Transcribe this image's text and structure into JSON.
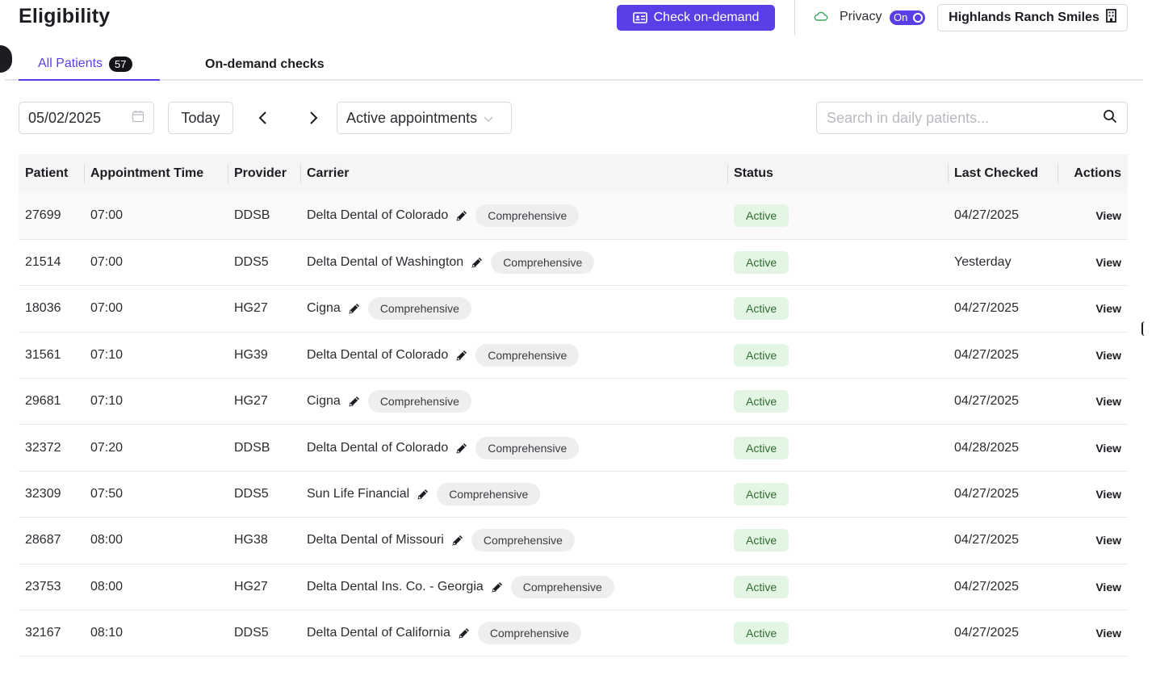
{
  "header": {
    "title": "Eligibility",
    "check_button_label": "Check on-demand",
    "privacy_label": "Privacy",
    "privacy_toggle_label": "On",
    "office_name": "Highlands Ranch Smiles"
  },
  "tabs": [
    {
      "label": "All Patients",
      "count": "57",
      "active": true
    },
    {
      "label": "On-demand checks",
      "active": false
    }
  ],
  "filters": {
    "date": "05/02/2025",
    "today_label": "Today",
    "appointment_filter": "Active appointments",
    "search_placeholder": "Search in daily patients..."
  },
  "table": {
    "columns": [
      "Patient",
      "Appointment Time",
      "Provider",
      "Carrier",
      "Status",
      "Last Checked",
      "Actions"
    ],
    "rows": [
      {
        "patient": "27699",
        "time": "07:00",
        "provider": "DDSB",
        "carrier": "Delta Dental of Colorado",
        "plan": "Comprehensive",
        "status": "Active",
        "last_checked": "04/27/2025",
        "action": "View"
      },
      {
        "patient": "21514",
        "time": "07:00",
        "provider": "DDS5",
        "carrier": "Delta Dental of Washington",
        "plan": "Comprehensive",
        "status": "Active",
        "last_checked": "Yesterday",
        "action": "View"
      },
      {
        "patient": "18036",
        "time": "07:00",
        "provider": "HG27",
        "carrier": "Cigna",
        "plan": "Comprehensive",
        "status": "Active",
        "last_checked": "04/27/2025",
        "action": "View"
      },
      {
        "patient": "31561",
        "time": "07:10",
        "provider": "HG39",
        "carrier": "Delta Dental of Colorado",
        "plan": "Comprehensive",
        "status": "Active",
        "last_checked": "04/27/2025",
        "action": "View"
      },
      {
        "patient": "29681",
        "time": "07:10",
        "provider": "HG27",
        "carrier": "Cigna",
        "plan": "Comprehensive",
        "status": "Active",
        "last_checked": "04/27/2025",
        "action": "View"
      },
      {
        "patient": "32372",
        "time": "07:20",
        "provider": "DDSB",
        "carrier": "Delta Dental of Colorado",
        "plan": "Comprehensive",
        "status": "Active",
        "last_checked": "04/28/2025",
        "action": "View"
      },
      {
        "patient": "32309",
        "time": "07:50",
        "provider": "DDS5",
        "carrier": "Sun Life Financial",
        "plan": "Comprehensive",
        "status": "Active",
        "last_checked": "04/27/2025",
        "action": "View"
      },
      {
        "patient": "28687",
        "time": "08:00",
        "provider": "HG38",
        "carrier": "Delta Dental of Missouri",
        "plan": "Comprehensive",
        "status": "Active",
        "last_checked": "04/27/2025",
        "action": "View"
      },
      {
        "patient": "23753",
        "time": "08:00",
        "provider": "HG27",
        "carrier": "Delta Dental Ins. Co. - Georgia",
        "plan": "Comprehensive",
        "status": "Active",
        "last_checked": "04/27/2025",
        "action": "View"
      },
      {
        "patient": "32167",
        "time": "08:10",
        "provider": "DDS5",
        "carrier": "Delta Dental of California",
        "plan": "Comprehensive",
        "status": "Active",
        "last_checked": "04/27/2025",
        "action": "View"
      }
    ]
  },
  "colors": {
    "accent": "#5b3ee6",
    "status_active_bg": "#e3f5e3",
    "status_active_text": "#2f6b31",
    "pill_bg": "#eeeeef"
  },
  "icons": {
    "check_button": "id-card-icon",
    "privacy": "cloud-icon",
    "office": "building-icon",
    "date": "calendar-icon",
    "prev": "chevron-left-icon",
    "next": "chevron-right-icon",
    "select": "chevron-down-icon",
    "search": "search-icon",
    "edit": "pencil-icon"
  }
}
